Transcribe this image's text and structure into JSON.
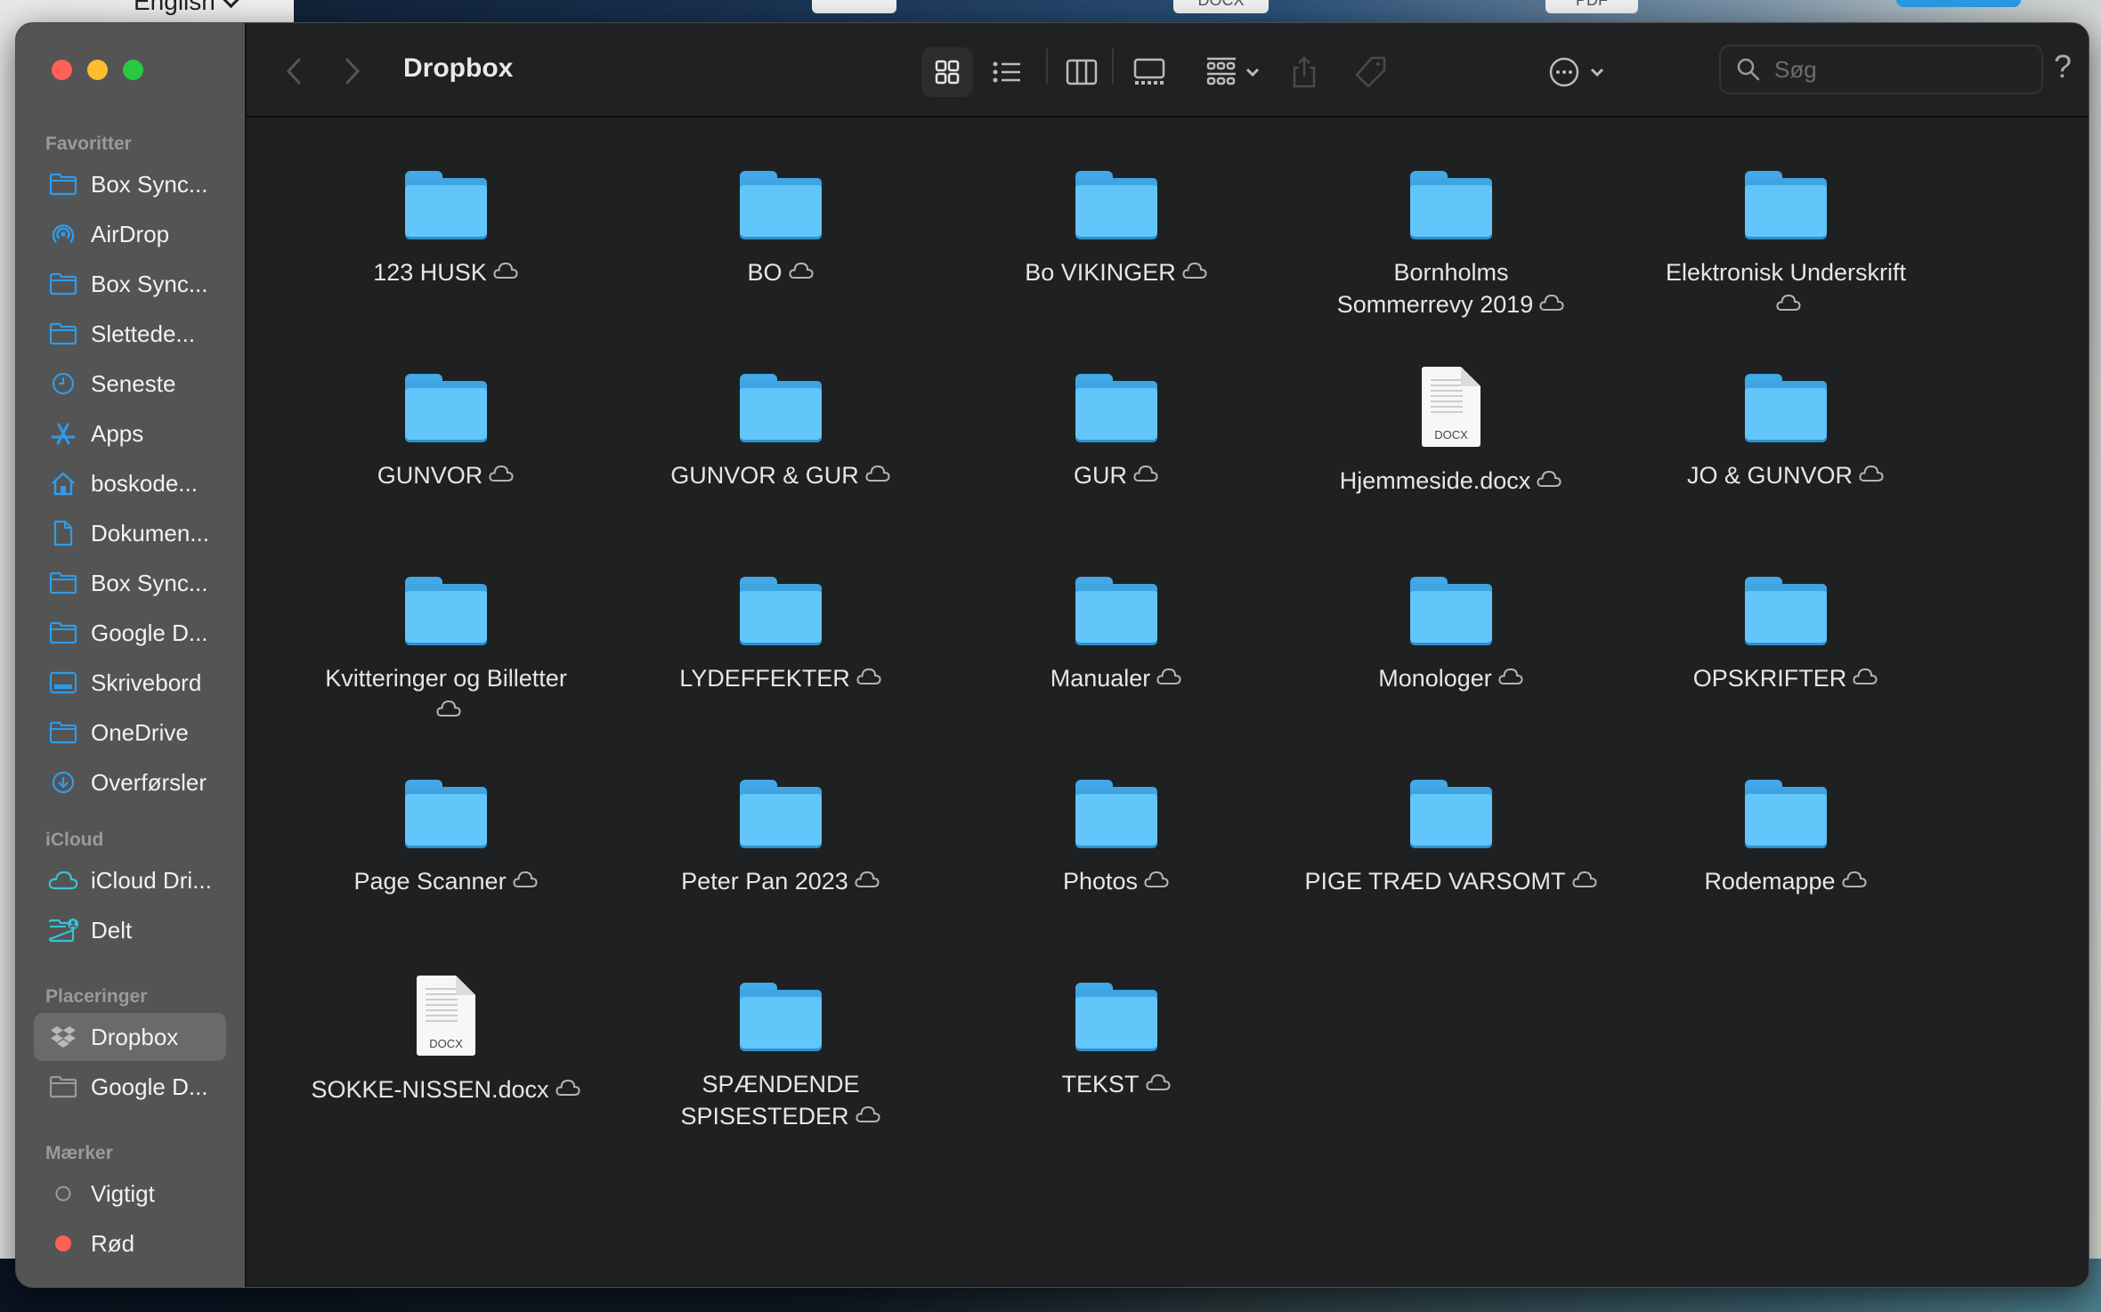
{
  "desktop": {
    "language_selector": "English",
    "background_buttons": [
      "",
      "DOCX",
      "PDF"
    ]
  },
  "window": {
    "title": "Dropbox",
    "traffic_lights": {
      "close": "#fe5f57",
      "minimize": "#febc2e",
      "maximize": "#28c840"
    }
  },
  "toolbar": {
    "back_icon": "chevron-left-icon",
    "forward_icon": "chevron-right-icon",
    "views": [
      {
        "name": "icon-view",
        "selected": true
      },
      {
        "name": "list-view",
        "selected": false
      },
      {
        "name": "column-view",
        "selected": false
      },
      {
        "name": "gallery-view",
        "selected": false
      }
    ],
    "group_icon": "group-by-icon",
    "share_icon": "share-icon",
    "tag_icon": "tag-icon",
    "more_icon": "ellipsis-circle-icon",
    "search_placeholder": "Søg",
    "search_value": "",
    "help_label": "?"
  },
  "sidebar": {
    "sections": [
      {
        "title": "Favoritter",
        "items": [
          {
            "label": "Box Sync...",
            "icon": "folder-icon"
          },
          {
            "label": "AirDrop",
            "icon": "airdrop-icon"
          },
          {
            "label": "Box Sync...",
            "icon": "folder-icon"
          },
          {
            "label": "Slettede...",
            "icon": "folder-icon"
          },
          {
            "label": "Seneste",
            "icon": "clock-icon"
          },
          {
            "label": "Apps",
            "icon": "apps-icon"
          },
          {
            "label": "boskode...",
            "icon": "home-icon"
          },
          {
            "label": "Dokumen...",
            "icon": "document-icon"
          },
          {
            "label": "Box Sync...",
            "icon": "folder-icon"
          },
          {
            "label": "Google D...",
            "icon": "folder-icon"
          },
          {
            "label": "Skrivebord",
            "icon": "desktop-icon"
          },
          {
            "label": "OneDrive",
            "icon": "folder-icon"
          },
          {
            "label": "Overførsler",
            "icon": "download-icon"
          }
        ]
      },
      {
        "title": "iCloud",
        "items": [
          {
            "label": "iCloud Dri...",
            "icon": "icloud-icon"
          },
          {
            "label": "Delt",
            "icon": "shared-folder-icon"
          }
        ]
      },
      {
        "title": "Placeringer",
        "items": [
          {
            "label": "Dropbox",
            "icon": "dropbox-icon",
            "active": true
          },
          {
            "label": "Google D...",
            "icon": "folder-icon"
          }
        ]
      },
      {
        "title": "Mærker",
        "items": [
          {
            "label": "Vigtigt",
            "icon": "tag-empty-icon"
          },
          {
            "label": "Rød",
            "icon": "tag-red-icon",
            "color": "#fe5f57"
          }
        ]
      }
    ]
  },
  "files": [
    {
      "name": "123 HUSK",
      "type": "folder",
      "cloud": true
    },
    {
      "name": "BO",
      "type": "folder",
      "cloud": true
    },
    {
      "name": "Bo VIKINGER",
      "type": "folder",
      "cloud": true
    },
    {
      "name": "Bornholms Sommerrevy 2019",
      "type": "folder",
      "cloud": true
    },
    {
      "name": "Elektronisk Underskrift",
      "type": "folder",
      "cloud": true
    },
    {
      "name": "GUNVOR",
      "type": "folder",
      "cloud": true
    },
    {
      "name": "GUNVOR & GUR",
      "type": "folder",
      "cloud": true
    },
    {
      "name": "GUR",
      "type": "folder",
      "cloud": true
    },
    {
      "name": "Hjemmeside.docx",
      "type": "docx",
      "ext": "DOCX",
      "cloud": true
    },
    {
      "name": "JO & GUNVOR",
      "type": "folder",
      "cloud": true
    },
    {
      "name": "Kvitteringer og Billetter",
      "type": "folder",
      "cloud": true
    },
    {
      "name": "LYDEFFEKTER",
      "type": "folder",
      "cloud": true
    },
    {
      "name": "Manualer",
      "type": "folder",
      "cloud": true
    },
    {
      "name": "Monologer",
      "type": "folder",
      "cloud": true
    },
    {
      "name": "OPSKRIFTER",
      "type": "folder",
      "cloud": true
    },
    {
      "name": "Page Scanner",
      "type": "folder",
      "cloud": true
    },
    {
      "name": "Peter Pan 2023",
      "type": "folder",
      "cloud": true
    },
    {
      "name": "Photos",
      "type": "folder",
      "cloud": true
    },
    {
      "name": "PIGE TRÆD VARSOMT",
      "type": "folder",
      "cloud": true
    },
    {
      "name": "Rodemappe",
      "type": "folder",
      "cloud": true
    },
    {
      "name": "SOKKE-NISSEN.docx",
      "type": "docx",
      "ext": "DOCX",
      "cloud": true
    },
    {
      "name": "SPÆNDENDE SPISESTEDER",
      "type": "folder",
      "cloud": true
    },
    {
      "name": "TEKST",
      "type": "folder",
      "cloud": true
    }
  ]
}
